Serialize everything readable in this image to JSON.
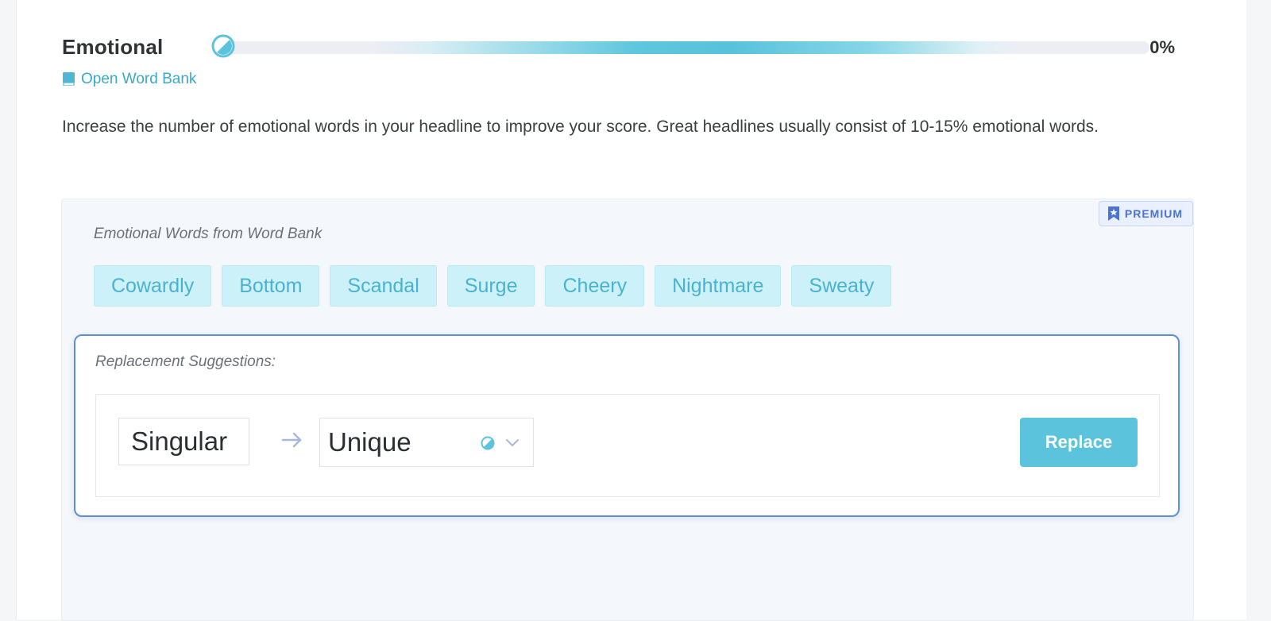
{
  "metric": {
    "title": "Emotional",
    "percent_label": "0%",
    "percent_value": 0,
    "accent_color": "#5bc3dc"
  },
  "word_bank_link": {
    "icon": "book-icon",
    "label": "Open Word Bank"
  },
  "description": "Increase the number of emotional words in your headline to improve your score. Great headlines usually consist of 10-15% emotional words.",
  "panel": {
    "badge": {
      "icon": "star-bookmark-icon",
      "label": "PREMIUM",
      "color": "#4a73d6"
    },
    "section_label": "Emotional Words from Word Bank",
    "words": [
      "Cowardly",
      "Bottom",
      "Scandal",
      "Surge",
      "Cheery",
      "Nightmare",
      "Sweaty"
    ],
    "suggestions": {
      "label": "Replacement Suggestions:",
      "original_word": "Singular",
      "arrow_icon": "arrow-right-icon",
      "selected_replacement": "Unique",
      "button_label": "Replace",
      "border_color": "#5b8fd6"
    }
  }
}
